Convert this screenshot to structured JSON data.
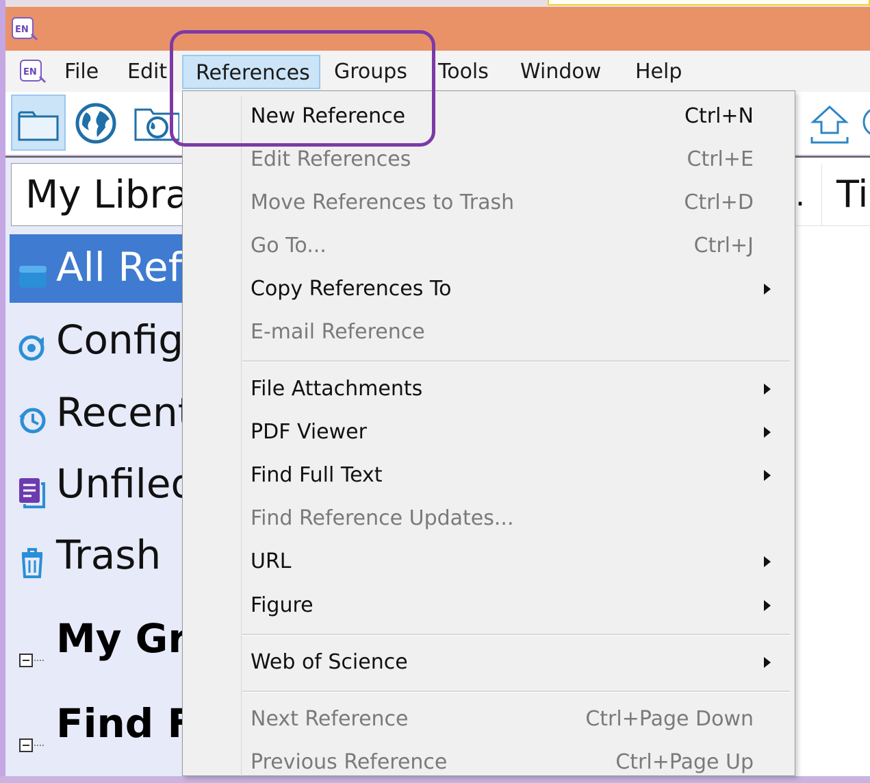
{
  "app": {
    "logo_text": "EN"
  },
  "menubar": {
    "items": [
      "File",
      "Edit",
      "References",
      "Groups",
      "Tools",
      "Window",
      "Help"
    ],
    "active": "References"
  },
  "left_panel": {
    "library_title": "My Libra",
    "items": [
      {
        "label": "All Refe",
        "icon": "all-references-icon",
        "selected": true
      },
      {
        "label": "Configu",
        "icon": "sync-configure-icon",
        "selected": false
      },
      {
        "label": "Recent",
        "icon": "recent-history-icon",
        "selected": false
      },
      {
        "label": "Unfiled",
        "icon": "unfiled-icon",
        "selected": false
      },
      {
        "label": "Trash",
        "icon": "trash-icon",
        "selected": false
      }
    ],
    "groups": [
      {
        "label": "My Gro",
        "icon": "collapse-icon"
      },
      {
        "label": "Find Fu",
        "icon": "collapse-icon"
      }
    ]
  },
  "right_pane": {
    "column_dot": ".",
    "column_header": "Ti"
  },
  "references_menu": {
    "new_reference": {
      "label": "New Reference",
      "shortcut": "Ctrl+N"
    },
    "edit_references": {
      "label": "Edit References",
      "shortcut": "Ctrl+E"
    },
    "move_to_trash": {
      "label": "Move References to Trash",
      "shortcut": "Ctrl+D"
    },
    "go_to": {
      "label": "Go To...",
      "shortcut": "Ctrl+J"
    },
    "copy_references_to": {
      "label": "Copy References To"
    },
    "email_reference": {
      "label": "E-mail Reference"
    },
    "file_attachments": {
      "label": "File Attachments"
    },
    "pdf_viewer": {
      "label": "PDF Viewer"
    },
    "find_full_text": {
      "label": "Find Full Text"
    },
    "find_reference_updates": {
      "label": "Find Reference Updates..."
    },
    "url": {
      "label": "URL"
    },
    "figure": {
      "label": "Figure"
    },
    "web_of_science": {
      "label": "Web of Science"
    },
    "next_reference": {
      "label": "Next Reference",
      "shortcut": "Ctrl+Page Down"
    },
    "previous_reference": {
      "label": "Previous Reference",
      "shortcut": "Ctrl+Page Up"
    }
  },
  "colors": {
    "titlebar": "#e99268",
    "highlight": "#7c3aa6",
    "selected_item": "#3f7bd0",
    "menu_active": "#cce4f7"
  }
}
